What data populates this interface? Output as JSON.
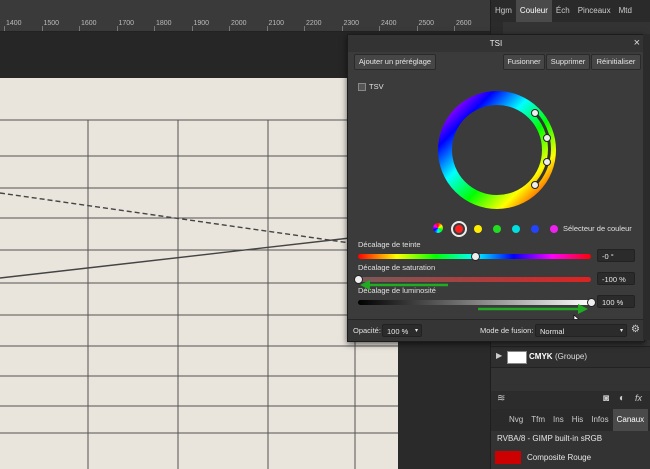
{
  "ruler": {
    "ticks": [
      "1400",
      "1500",
      "1600",
      "1700",
      "1800",
      "1900",
      "2000",
      "2100",
      "2200",
      "2300",
      "2400",
      "2500",
      "2600"
    ]
  },
  "right_panel": {
    "tabs": [
      "Hgm",
      "Couleur",
      "Éch",
      "Pinceaux",
      "Mtd"
    ],
    "active_tab": "Couleur",
    "layer_name": "CMYK",
    "layer_suffix": "(Groupe)",
    "bottom_tabs": [
      "Nvg",
      "Tfm",
      "Ins",
      "His",
      "Infos",
      "Canaux"
    ],
    "active_bottom_tab": "Canaux",
    "profile": "RVBA/8 - GIMP built-in sRGB",
    "channel_label": "Composite Rouge",
    "channel_color": "#cc0000",
    "fx_label": "fx"
  },
  "dialog": {
    "title": "TSI",
    "close": "×",
    "buttons": {
      "add_preset": "Ajouter un préréglage",
      "merge": "Fusionner",
      "delete": "Supprimer",
      "reset": "Réinitialiser"
    },
    "tsv_label": "TSV",
    "color_selector_label": "Sélecteur de couleur",
    "swatches": [
      "#ff2020",
      "#ffee00",
      "#22dd22",
      "#00e0e0",
      "#2244ff",
      "#ee22ee"
    ],
    "hue_label": "Décalage de teinte",
    "hue_value": "-0 °",
    "hue_level": 0.5,
    "saturation_label": "Décalage de saturation",
    "saturation_value": "-100 %",
    "saturation_level": 0.0,
    "lightness_label": "Décalage de luminosité",
    "lightness_value": "100 %",
    "lightness_level": 1.0,
    "opacity_label": "Opacité:",
    "opacity_value": "100 %",
    "blend_label": "Mode de fusion:",
    "blend_value": "Normal"
  },
  "colors": {
    "accent": "#1f9b3a",
    "arrow": "#22aa22"
  }
}
